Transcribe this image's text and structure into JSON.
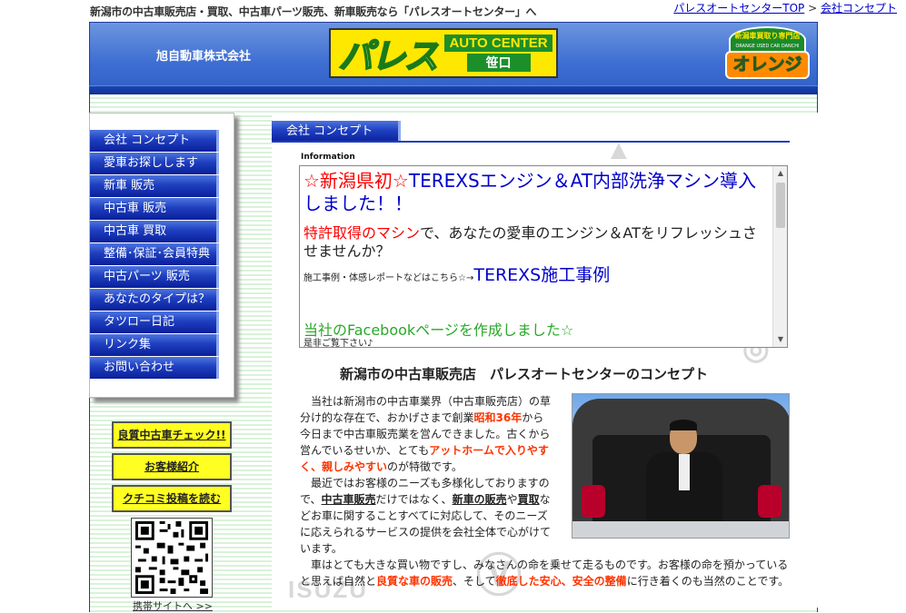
{
  "top": {
    "tagline": "新潟市の中古車販売店・買取、中古車パーツ販売、新車販売なら「パレスオートセンター」へ",
    "link_top": "パレスオートセンターTOP",
    "separator": " > ",
    "link_current": "会社コンセプト"
  },
  "header": {
    "company": "旭自動車株式会社",
    "logo_kana": "パレス",
    "logo_auto_center": "AUTO CENTER",
    "logo_branch": "笹口",
    "logo_orange_top": "新潟車買取り専門店",
    "logo_orange_small": "ORANGE USED CAR DANCHI",
    "logo_orange_main": "オレンジ"
  },
  "sidebar": {
    "nav": [
      "会社 コンセプト",
      "愛車お探しします",
      "新車 販売",
      "中古車 販売",
      "中古車 買取",
      "整備･保証･会員特典",
      "中古パーツ 販売",
      "あなたのタイプは？",
      "タツロー日記",
      "リンク集",
      "お問い合わせ"
    ],
    "btn_check": "良質中古車チェック!!",
    "btn_customers": "お客様紹介",
    "btn_reviews": "クチコミ投稿を読む",
    "qr_caption": "携帯サイトへ >>"
  },
  "main": {
    "section_title": "会社 コンセプト",
    "info_label": "Information",
    "info_star1": "☆新潟県初☆",
    "info_h1": "TEREXSエンジン＆AT内部洗浄マシン導入しました！！",
    "info_h2_red": "特許取得のマシン",
    "info_h2_rest": "で、あなたの愛車のエンジン＆ATをリフレッシュさせませんか？",
    "info_small": "施工事例・体感レポートなどはこちら☆→",
    "info_link": "TEREXS施工事例",
    "info_fb": "当社のFacebookページを作成しました☆",
    "info_end": "是非ご覧下さい♪",
    "concept_title": "新潟市の中古車販売店　パレスオートセンターのコンセプト",
    "p1_a": "　当社は新潟市の中古車業界（中古車販売店）の草分け的な存在で、おかげさまで創業",
    "p1_year": "昭和36年",
    "p1_b": "から今日まで中古車販売業を営んできました。古くから営んでいるせいか、とても",
    "p1_hl": "アットホームで入りやすく、親しみやすい",
    "p1_c": "のが特徴です。",
    "p2_a": "　最近ではお客様のニーズも多様化しておりますので、",
    "p2_used": "中古車販売",
    "p2_b": "だけではなく、",
    "p2_new": "新車の販売",
    "p2_ya": "や",
    "p2_buy": "買取",
    "p2_c": "などお車に関することすべてに対応して、そのニーズに応えられるサービスの提供を会社全体で心がけています。",
    "p3_a": "　車はとても大きな買い物ですし、みなさんの命を乗せて走るものです。お客様の命を預かっていると思えば自然と",
    "p3_hl1": "良質な車の販売",
    "p3_b": "、そして",
    "p3_hl2": "徹底した安心、安全の整備",
    "p3_c": "に行き着くのも当然のことです。"
  },
  "colors": {
    "nav_blue": "#1e3fbf",
    "header_blue": "#3f6fd2",
    "accent_red": "#ff3300",
    "link_blue": "#0000cc",
    "button_yellow": "#ffff22"
  }
}
